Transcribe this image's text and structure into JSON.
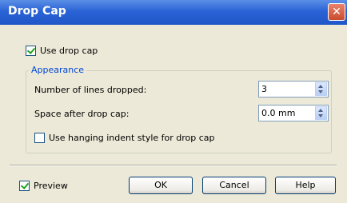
{
  "window": {
    "title": "Drop Cap",
    "close_glyph": "✕"
  },
  "use_drop_cap": {
    "label": "Use drop cap",
    "checked": true
  },
  "appearance": {
    "title": "Appearance",
    "lines_dropped": {
      "label": "Number of lines dropped:",
      "value": "3"
    },
    "space_after": {
      "label": "Space after drop cap:",
      "value": "0.0 mm"
    },
    "hanging_indent": {
      "label": "Use hanging indent style for drop cap",
      "checked": false
    }
  },
  "preview": {
    "label": "Preview",
    "checked": true
  },
  "buttons": {
    "ok": "OK",
    "cancel": "Cancel",
    "help": "Help"
  },
  "icons": {
    "close": "close-icon",
    "spin_up": "spin-up-icon",
    "spin_down": "spin-down-icon"
  }
}
